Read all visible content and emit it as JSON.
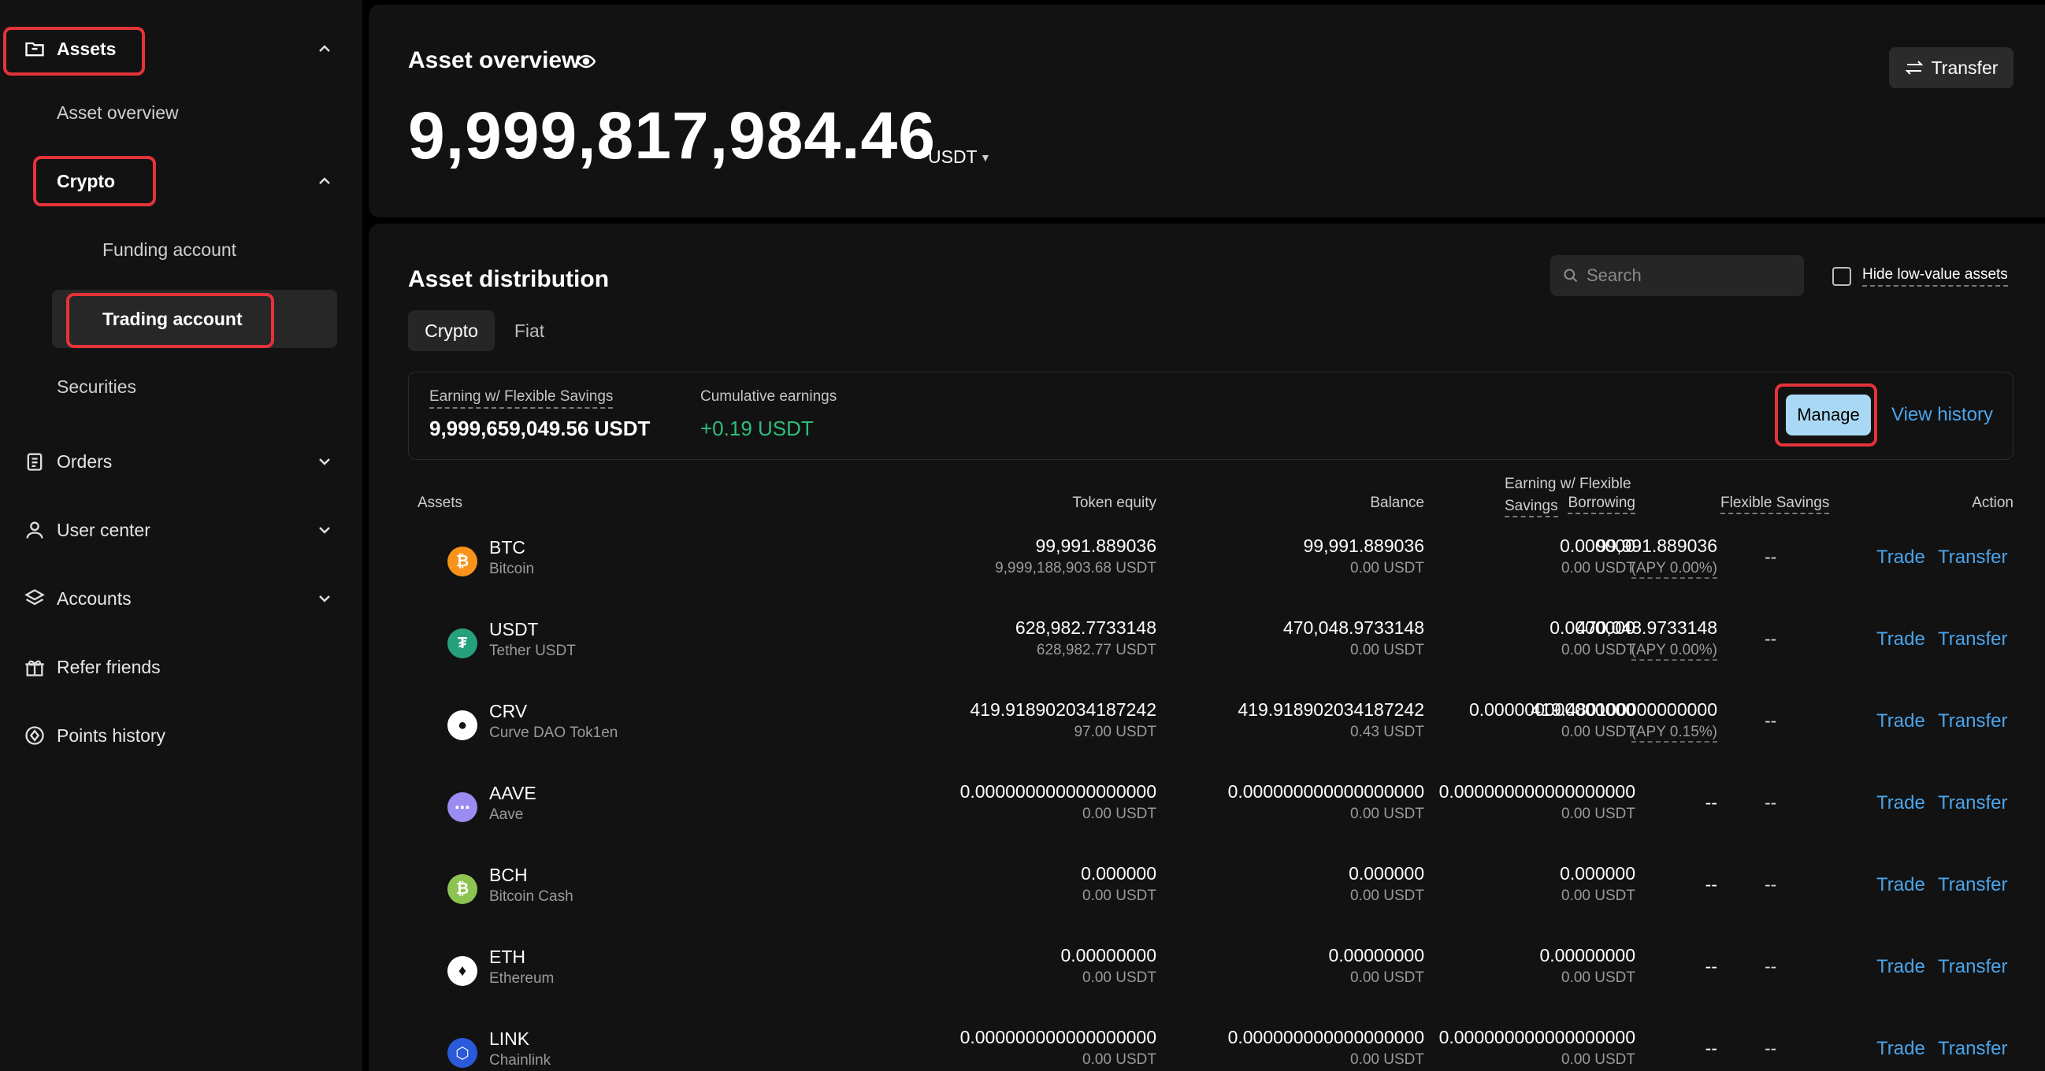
{
  "sidebar": {
    "assets_label": "Assets",
    "asset_overview": "Asset overview",
    "crypto_label": "Crypto",
    "funding_account": "Funding account",
    "trading_account": "Trading account",
    "securities": "Securities",
    "orders": "Orders",
    "user_center": "User center",
    "accounts": "Accounts",
    "refer_friends": "Refer friends",
    "points_history": "Points history"
  },
  "overview": {
    "title": "Asset overview",
    "total_value": "9,999,817,984.46",
    "currency": "USDT",
    "transfer_button": "Transfer"
  },
  "distribution": {
    "title": "Asset distribution",
    "search_placeholder": "Search",
    "hide_low_value": "Hide low-value assets",
    "tabs": [
      "Crypto",
      "Fiat"
    ],
    "earning_label": "Earning w/ Flexible Savings",
    "earning_value": "9,999,659,049.56 USDT",
    "cumulative_label": "Cumulative earnings",
    "cumulative_value": "+0.19 USDT",
    "manage_button": "Manage",
    "view_history": "View history"
  },
  "table": {
    "headers": {
      "assets": "Assets",
      "token_equity": "Token equity",
      "balance": "Balance",
      "borrowing": "Borrowing",
      "earning_l1": "Earning w/ Flexible",
      "earning_l2": "Savings",
      "flexible_savings": "Flexible Savings",
      "action": "Action"
    },
    "trade_label": "Trade",
    "transfer_label": "Transfer",
    "dash": "--",
    "rows": [
      {
        "symbol": "BTC",
        "name": "Bitcoin",
        "equity": "99,991.889036",
        "equity_usdt": "9,999,188,903.68 USDT",
        "balance": "99,991.889036",
        "balance_usdt": "0.00 USDT",
        "borrowing": "0.000000",
        "borrowing_usdt": "0.00 USDT",
        "earning": "99,991.889036",
        "apy": "(APY 0.00%)",
        "flexible": "--",
        "color": "#f7931a",
        "glyph": "₿"
      },
      {
        "symbol": "USDT",
        "name": "Tether USDT",
        "equity": "628,982.7733148",
        "equity_usdt": "628,982.77 USDT",
        "balance": "470,048.9733148",
        "balance_usdt": "0.00 USDT",
        "borrowing": "0.0000000",
        "borrowing_usdt": "0.00 USDT",
        "earning": "470,048.9733148",
        "apy": "(APY 0.00%)",
        "flexible": "--",
        "color": "#26a17b",
        "glyph": "₮"
      },
      {
        "symbol": "CRV",
        "name": "Curve DAO Tok1en",
        "equity": "419.918902034187242",
        "equity_usdt": "97.00 USDT",
        "balance": "419.918902034187242",
        "balance_usdt": "0.43 USDT",
        "borrowing": "0.000000000000000",
        "borrowing_usdt": "0.00 USDT",
        "earning": "419.480100000000000",
        "apy": "(APY 0.15%)",
        "flexible": "--",
        "color": "#ffffff",
        "glyph": "●"
      },
      {
        "symbol": "AAVE",
        "name": "Aave",
        "equity": "0.000000000000000000",
        "equity_usdt": "0.00 USDT",
        "balance": "0.000000000000000000",
        "balance_usdt": "0.00 USDT",
        "borrowing": "0.000000000000000000",
        "borrowing_usdt": "0.00 USDT",
        "earning": "--",
        "apy": "",
        "flexible": "--",
        "color": "#9a8cf0",
        "glyph": "⋯"
      },
      {
        "symbol": "BCH",
        "name": "Bitcoin Cash",
        "equity": "0.000000",
        "equity_usdt": "0.00 USDT",
        "balance": "0.000000",
        "balance_usdt": "0.00 USDT",
        "borrowing": "0.000000",
        "borrowing_usdt": "0.00 USDT",
        "earning": "--",
        "apy": "",
        "flexible": "--",
        "color": "#8dc351",
        "glyph": "₿"
      },
      {
        "symbol": "ETH",
        "name": "Ethereum",
        "equity": "0.00000000",
        "equity_usdt": "0.00 USDT",
        "balance": "0.00000000",
        "balance_usdt": "0.00 USDT",
        "borrowing": "0.00000000",
        "borrowing_usdt": "0.00 USDT",
        "earning": "--",
        "apy": "",
        "flexible": "--",
        "color": "#ffffff",
        "glyph": "♦"
      },
      {
        "symbol": "LINK",
        "name": "Chainlink",
        "equity": "0.000000000000000000",
        "equity_usdt": "0.00 USDT",
        "balance": "0.000000000000000000",
        "balance_usdt": "0.00 USDT",
        "borrowing": "0.000000000000000000",
        "borrowing_usdt": "0.00 USDT",
        "earning": "--",
        "apy": "",
        "flexible": "--",
        "color": "#2a5ada",
        "glyph": "⬡"
      }
    ]
  }
}
